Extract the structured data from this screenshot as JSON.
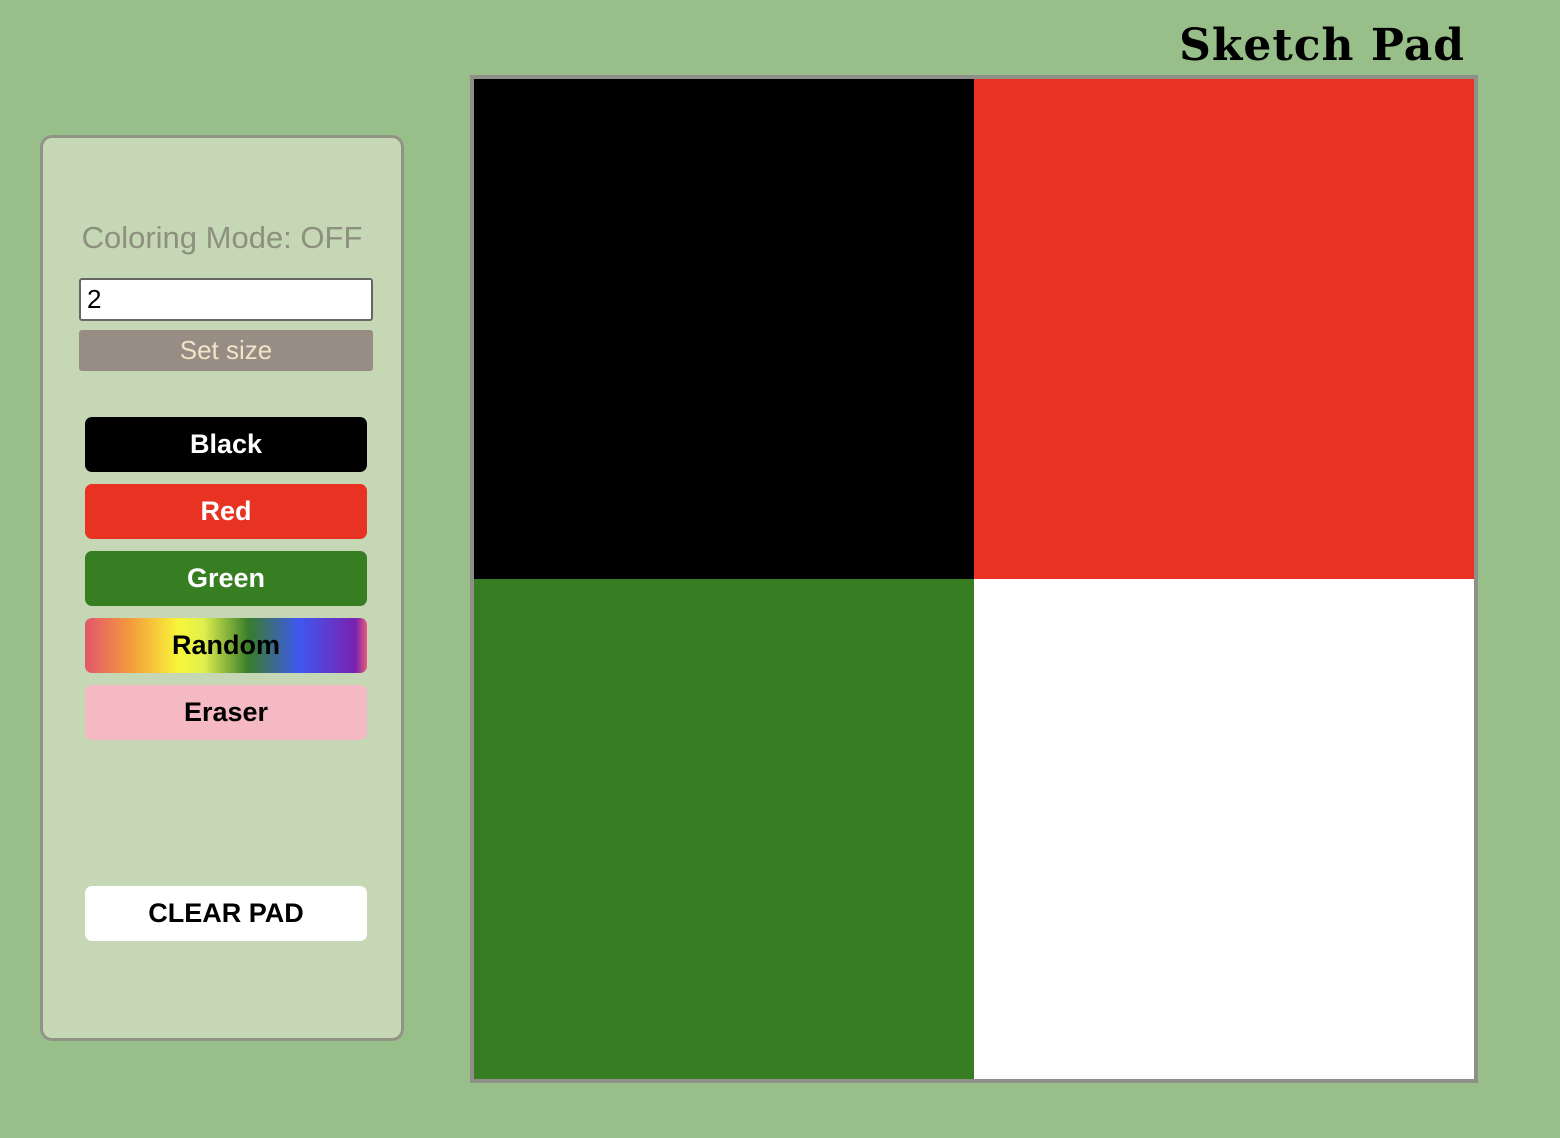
{
  "app": {
    "title": "Sketch Pad"
  },
  "controls": {
    "mode_text": "Coloring Mode: OFF",
    "size_value": "2",
    "set_size_label": "Set size",
    "buttons": {
      "black": "Black",
      "red": "Red",
      "green": "Green",
      "random": "Random",
      "eraser": "Eraser",
      "clear": "CLEAR PAD"
    }
  },
  "colors": {
    "background": "#98bf8a",
    "panel": "#c5d7b4",
    "black": "#000000",
    "red": "#e83323",
    "green": "#377e22",
    "eraser": "#f4b9c3",
    "white": "#ffffff"
  },
  "pad": {
    "grid_size": 2,
    "cells": [
      {
        "color": "#000000"
      },
      {
        "color": "#e83323"
      },
      {
        "color": "#377e22"
      },
      {
        "color": "#ffffff"
      }
    ]
  }
}
